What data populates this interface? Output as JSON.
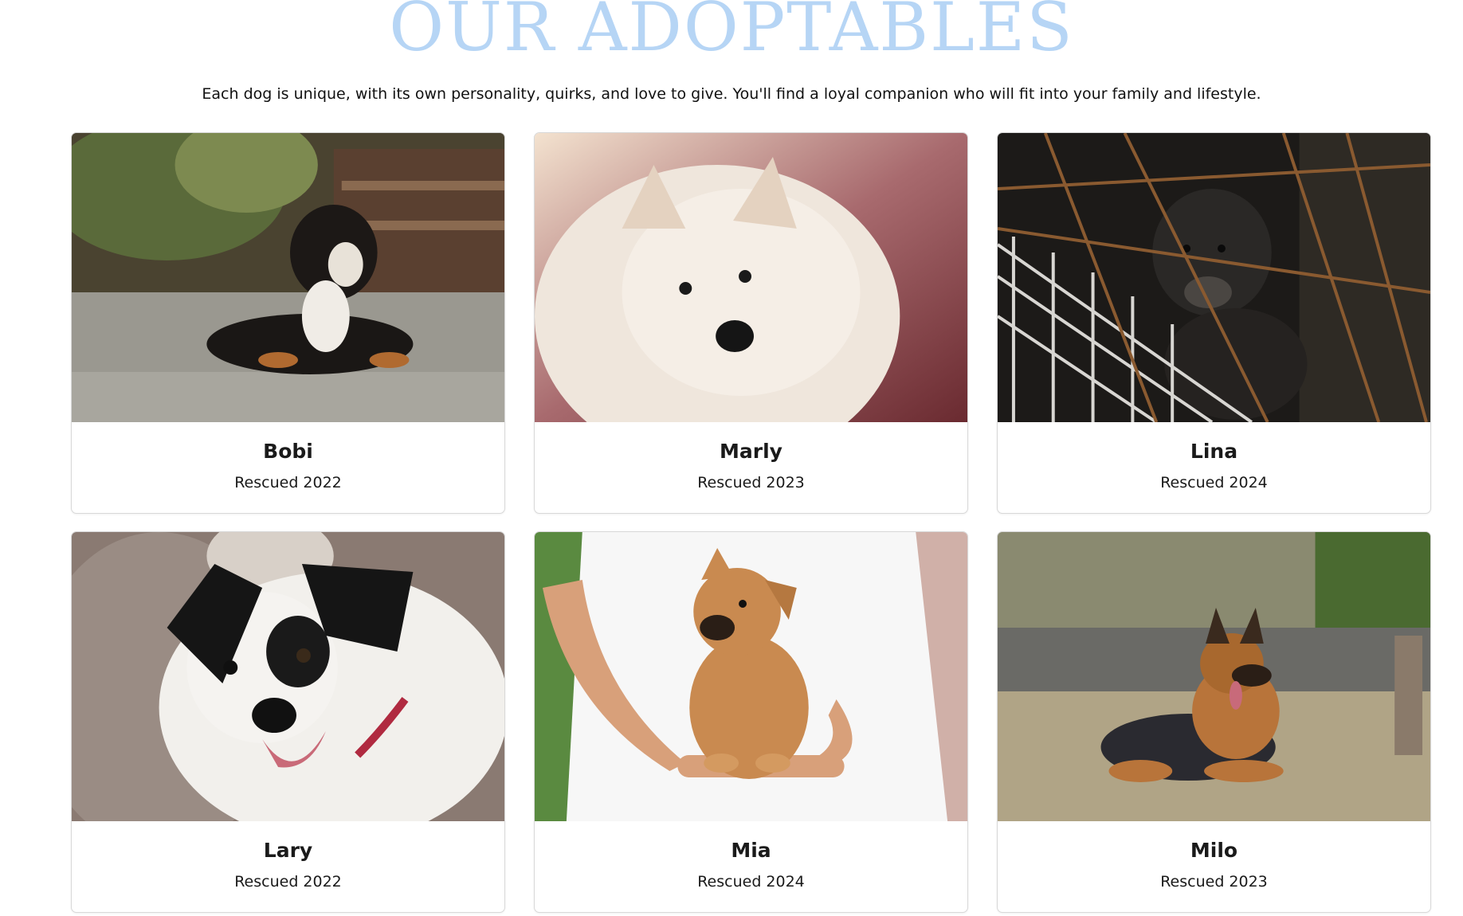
{
  "header": {
    "title": "OUR ADOPTABLES",
    "subtitle": "Each dog is unique, with its own personality, quirks, and love to give. You'll find a loyal companion who will fit into your family and lifestyle."
  },
  "colors": {
    "title": "#b6d5f5",
    "card_border": "#d8d8d8",
    "text": "#1a1a1a"
  },
  "dogs": [
    {
      "name": "Bobi",
      "rescued": "Rescued 2022",
      "photo_icon": "dog-lying-on-pavement-photo"
    },
    {
      "name": "Marly",
      "rescued": "Rescued 2023",
      "photo_icon": "white-fluffy-puppy-photo"
    },
    {
      "name": "Lina",
      "rescued": "Rescued 2024",
      "photo_icon": "puppy-behind-cage-photo"
    },
    {
      "name": "Lary",
      "rescued": "Rescued 2022",
      "photo_icon": "black-white-dog-smiling-photo"
    },
    {
      "name": "Mia",
      "rescued": "Rescued 2024",
      "photo_icon": "puppy-held-in-hands-photo"
    },
    {
      "name": "Milo",
      "rescued": "Rescued 2023",
      "photo_icon": "german-shepherd-lying-photo"
    }
  ]
}
